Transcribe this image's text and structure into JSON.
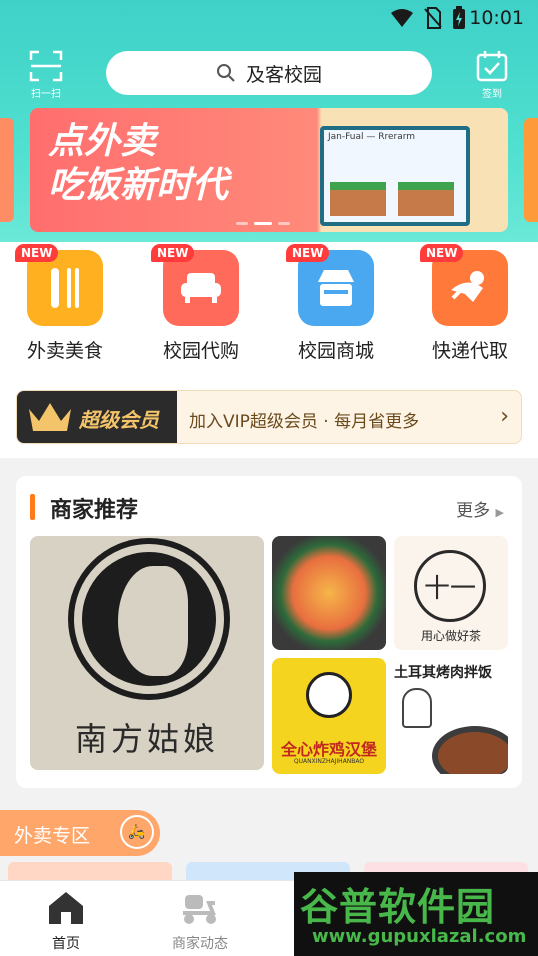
{
  "status_bar": {
    "time": "10:01"
  },
  "header": {
    "scan_label": "扫一扫",
    "checkin_label": "签到",
    "search_text": "及客校园"
  },
  "banner": {
    "headline_1": "点外卖",
    "headline_2": "吃饭新时代",
    "shop_sign": "Jan-Fual — Rrerarm"
  },
  "categories": [
    {
      "label": "外卖美食",
      "badge": "NEW",
      "color": "#ffb020",
      "icon": "utensils-icon"
    },
    {
      "label": "校园代购",
      "badge": "NEW",
      "color": "#ff6a5a",
      "icon": "sofa-icon"
    },
    {
      "label": "校园商城",
      "badge": "NEW",
      "color": "#4aa8f0",
      "icon": "store-icon"
    },
    {
      "label": "快递代取",
      "badge": "NEW",
      "color": "#ff7a3a",
      "icon": "courier-icon"
    }
  ],
  "vip": {
    "badge": "超级会员",
    "text": "加入VIP超级会员 · 每月省更多",
    "arrow": "›"
  },
  "recommend": {
    "title": "商家推荐",
    "more": "更多",
    "tiles": [
      {
        "name": "南方姑娘"
      },
      {
        "name": ""
      },
      {
        "name": "十一",
        "sub": "用心做好茶"
      },
      {
        "name": "全心炸鸡汉堡",
        "sub": "QUANXINZHAJIHANBAO"
      },
      {
        "name": "土耳其烤肉拌饭"
      }
    ]
  },
  "takeout_zone": {
    "title": "外卖专区"
  },
  "tabbar": [
    {
      "label": "首页",
      "active": true
    },
    {
      "label": "商家动态",
      "active": false
    }
  ],
  "watermark": {
    "brand": "谷普软件园",
    "url": "www.gupuxlazal.com"
  },
  "colors": {
    "accent": "#3fd0c8",
    "orange": "#ff7a1a",
    "new_badge": "#ff3b3b"
  }
}
